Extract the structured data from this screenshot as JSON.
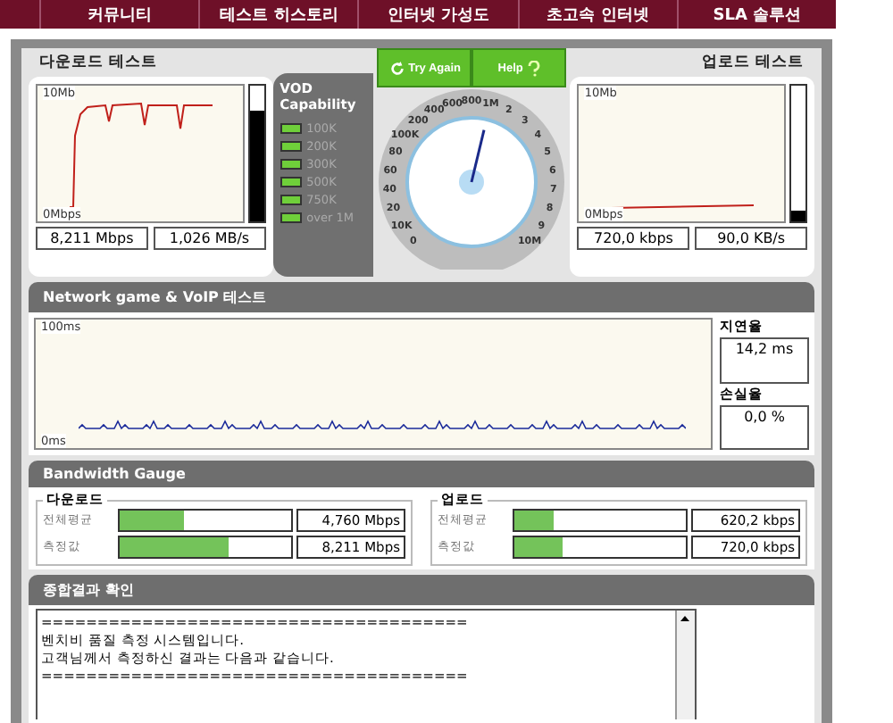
{
  "nav": {
    "items": [
      {
        "label": "커뮤니티"
      },
      {
        "label": "테스트 히스토리"
      },
      {
        "label": "인터넷 가성도"
      },
      {
        "label": "초고속 인터넷"
      },
      {
        "label": "SLA 솔루션"
      }
    ]
  },
  "download_test": {
    "title": "다운로드 테스트",
    "y_top": "10Mb",
    "y_bottom": "0Mbps",
    "level": 0.82,
    "speed": "8,211 Mbps",
    "rate": "1,026 MB/s"
  },
  "vod": {
    "title": "VOD Capability",
    "items": [
      {
        "label": "100K",
        "lit": true
      },
      {
        "label": "200K",
        "lit": true
      },
      {
        "label": "300K",
        "lit": true
      },
      {
        "label": "500K",
        "lit": true
      },
      {
        "label": "750K",
        "lit": true
      },
      {
        "label": "over 1M",
        "lit": true
      }
    ]
  },
  "dial": {
    "buttons": [
      {
        "label": "Try Again",
        "kind": "retry"
      },
      {
        "label": "Help",
        "kind": "help"
      }
    ],
    "left_labels": [
      "100K",
      "80",
      "60",
      "40",
      "20",
      "10K",
      "0"
    ],
    "right_labels": [
      "200",
      "400",
      "600",
      "800",
      "1M",
      "2",
      "3",
      "4",
      "5",
      "6",
      "7",
      "8",
      "9",
      "10M"
    ],
    "level": 0.55
  },
  "upload_test": {
    "title": "업로드 테스트",
    "y_top": "10Mb",
    "y_bottom": "0Mbps",
    "level": 0.08,
    "speed": "720,0 kbps",
    "rate": "90,0 KB/s"
  },
  "network": {
    "title": "Network game & VoIP 테스트",
    "y_top": "100ms",
    "y_bottom": "0ms",
    "latency_label": "지연율",
    "latency": "14,2 ms",
    "loss_label": "손실율",
    "loss": "0,0 %"
  },
  "bandwidth": {
    "title": "Bandwidth Gauge",
    "groups": [
      {
        "title": "다운로드",
        "rows": [
          {
            "label": "전체평균",
            "level": 0.37,
            "value": "4,760 Mbps"
          },
          {
            "label": "측정값",
            "level": 0.64,
            "value": "8,211 Mbps"
          }
        ]
      },
      {
        "title": "업로드",
        "rows": [
          {
            "label": "전체평균",
            "level": 0.23,
            "value": "620,2 kbps"
          },
          {
            "label": "측정값",
            "level": 0.28,
            "value": "720,0 kbps"
          }
        ]
      }
    ]
  },
  "summary": {
    "title": "종합결과 확인",
    "lines": [
      "======================================",
      "벤치비 품질 측정 시스템입니다.",
      "고객님께서 측정하신 결과는 다음과 같습니다.",
      "======================================"
    ]
  }
}
